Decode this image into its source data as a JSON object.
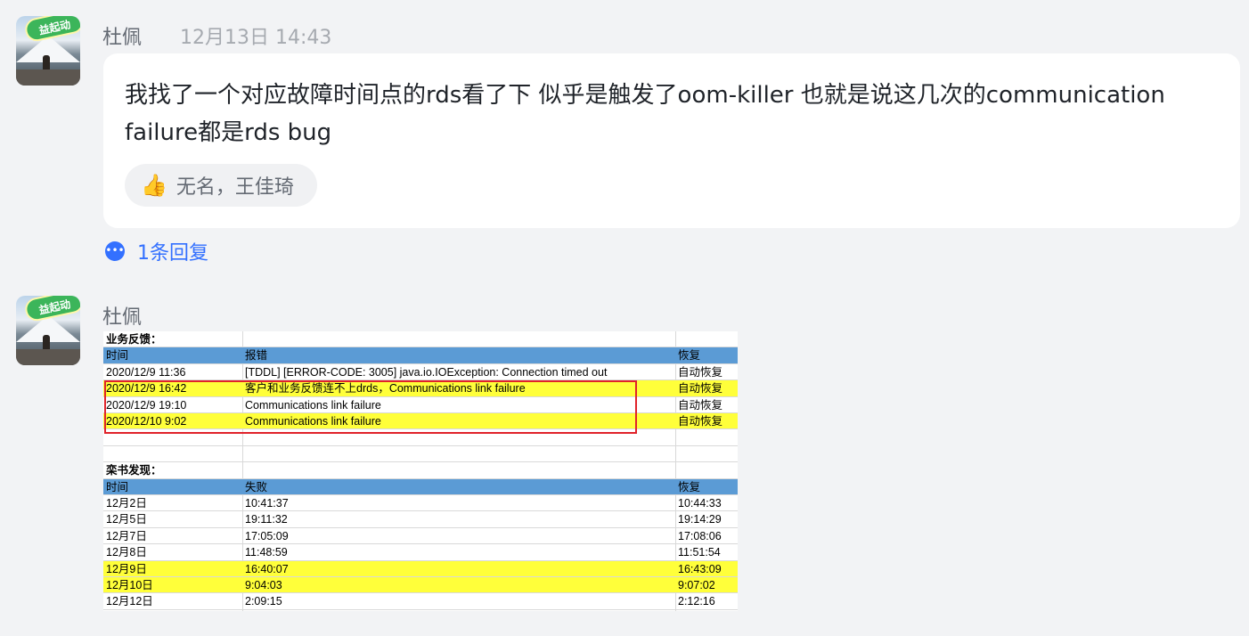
{
  "messages": [
    {
      "sender": "杜佩",
      "avatar_badge": "益起动",
      "timestamp": "12月13日 14:43",
      "text": "我找了一个对应故障时间点的rds看了下 似乎是触发了oom-killer 也就是说这几次的communication failure都是rds bug",
      "reaction": {
        "icon": "thumbs-up-icon",
        "names": "无名，王佳琦"
      },
      "reply_count_label": "1条回复"
    },
    {
      "sender": "杜佩",
      "avatar_badge": "益起动"
    }
  ],
  "sheet": {
    "section1": {
      "title": "业务反馈：",
      "headers": [
        "时间",
        "报错",
        "恢复"
      ],
      "rows": [
        [
          "2020/12/9 11:36",
          " [TDDL] [ERROR-CODE: 3005] java.io.IOException: Connection timed out",
          "自动恢复"
        ],
        [
          "2020/12/9 16:42",
          "客户和业务反馈连不上drds，Communications link failure",
          "自动恢复"
        ],
        [
          "2020/12/9 19:10",
          "Communications link failure",
          "自动恢复"
        ],
        [
          "2020/12/10 9:02",
          "Communications link failure",
          "自动恢复"
        ]
      ]
    },
    "section2": {
      "title": "栾书发现：",
      "headers": [
        "时间",
        "失败",
        "恢复"
      ],
      "rows": [
        [
          "12月2日",
          "10:41:37",
          "10:44:33"
        ],
        [
          "12月5日",
          "19:11:32",
          "19:14:29"
        ],
        [
          "12月7日",
          "17:05:09",
          "17:08:06"
        ],
        [
          "12月8日",
          "11:48:59",
          "11:51:54"
        ],
        [
          "12月9日",
          "16:40:07",
          "16:43:09"
        ],
        [
          "12月10日",
          "9:04:03",
          "9:07:02"
        ],
        [
          "12月12日",
          "2:09:15",
          "2:12:16"
        ]
      ]
    },
    "colors": {
      "header": "#5b9bd5",
      "highlight": "#ffff3a",
      "box": "#e0222a"
    }
  }
}
